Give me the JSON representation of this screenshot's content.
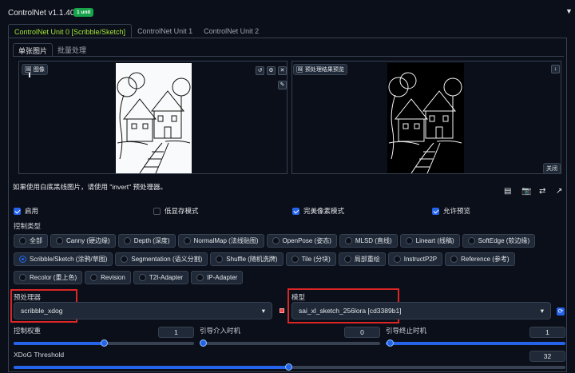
{
  "header": {
    "title": "ControlNet v1.1.406",
    "badge": "1 unit"
  },
  "tabs": [
    "ControlNet Unit 0 [Scribble/Sketch]",
    "ControlNet Unit 1",
    "ControlNet Unit 2"
  ],
  "subtabs": [
    "单张图片",
    "批量处理"
  ],
  "image_panel": {
    "image_label": "图像",
    "preview_label": "预处理结果预览",
    "close_label": "关闭"
  },
  "hint": "如果使用白底黑线图片，请使用 \"invert\" 预处理器。",
  "checkboxes": [
    {
      "label": "启用",
      "checked": true
    },
    {
      "label": "低显存模式",
      "checked": false
    },
    {
      "label": "完美像素模式",
      "checked": true
    },
    {
      "label": "允许预览",
      "checked": true
    }
  ],
  "control_type_label": "控制类型",
  "control_types_row1": [
    "全部",
    "Canny (硬边缘)",
    "Depth (深度)",
    "NormalMap (法线贴图)",
    "OpenPose (姿态)",
    "MLSD (直线)",
    "Lineart (线稿)",
    "SoftEdge (软边缘)"
  ],
  "control_types_row2": [
    "Scribble/Sketch (涂鸦/草图)",
    "Segmentation (语义分割)",
    "Shuffle (随机洗牌)",
    "Tile (分块)",
    "局部重绘",
    "InstructP2P",
    "Reference (参考)"
  ],
  "control_types_row3": [
    "Recolor (重上色)",
    "Revision",
    "T2I-Adapter",
    "IP-Adapter"
  ],
  "selected_control_type": "Scribble/Sketch (涂鸦/草图)",
  "preprocessor": {
    "label": "预处理器",
    "value": "scribble_xdog"
  },
  "model": {
    "label": "模型",
    "value": "sai_xl_sketch_256lora [cd3389b1]"
  },
  "sliders": {
    "weight": {
      "label": "控制权重",
      "value": "1",
      "fraction": 0.5
    },
    "start": {
      "label": "引导介入时机",
      "value": "0",
      "fraction": 0.0
    },
    "end": {
      "label": "引导终止时机",
      "value": "1",
      "fraction": 1.0
    },
    "xdog": {
      "label": "XDoG Threshold",
      "value": "32",
      "fraction": 0.5
    }
  },
  "icons": [
    "upload-icon",
    "refresh-icon",
    "camera-icon",
    "swap-icon",
    "arrow-icon"
  ],
  "accent_color": "#2563eb",
  "highlight_color": "#dc2626"
}
